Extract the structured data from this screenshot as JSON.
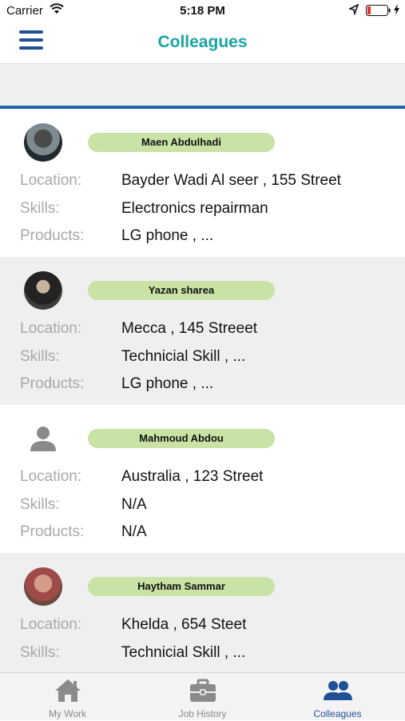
{
  "status_bar": {
    "carrier": "Carrier",
    "time": "5:18 PM"
  },
  "nav": {
    "title": "Colleagues"
  },
  "colleagues": [
    {
      "name": "Maen Abdulhadi",
      "location_label": "Location:",
      "location": "Bayder Wadi Al seer , 155 Street",
      "skills_label": "Skills:",
      "skills": "Electronics repairman",
      "products_label": "Products:",
      "products": "LG phone , ..."
    },
    {
      "name": "Yazan sharea",
      "location_label": "Location:",
      "location": "Mecca  , 145 Streeet",
      "skills_label": "Skills:",
      "skills": "Technicial Skill , ...",
      "products_label": "Products:",
      "products": "LG phone , ..."
    },
    {
      "name": "Mahmoud Abdou",
      "location_label": "Location:",
      "location": "Australia  , 123 Street",
      "skills_label": "Skills:",
      "skills": "N/A",
      "products_label": "Products:",
      "products": "N/A"
    },
    {
      "name": "Haytham Sammar",
      "location_label": "Location:",
      "location": "Khelda , 654 Steet",
      "skills_label": "Skills:",
      "skills": "Technicial Skill , ..."
    }
  ],
  "tabs": [
    {
      "label": "My Work",
      "icon": "home-icon"
    },
    {
      "label": "Job History",
      "icon": "briefcase-icon"
    },
    {
      "label": "Colleagues",
      "icon": "people-icon"
    }
  ],
  "colors": {
    "accent_title": "#1aa3a3",
    "brand_blue": "#1f4f95",
    "name_pill": "#c9e3a6"
  }
}
